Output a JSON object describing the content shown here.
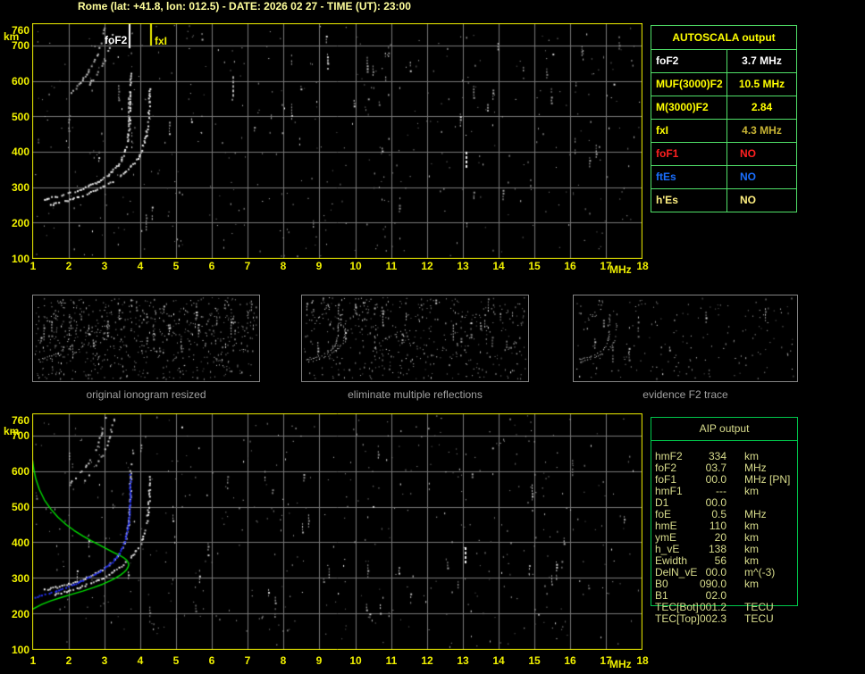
{
  "title": "Rome (lat: +41.8, lon: 012.5) - DATE: 2026 02 27 - TIME (UT): 23:00",
  "colors": {
    "background": "#000000",
    "title_text": "#FFFF9C",
    "axis_text": "#F0F000",
    "plot_border": "#F0F000",
    "grid": "#787878",
    "echo_white": "#FFFFFF",
    "autoscala_border": "#50E068",
    "aip_border": "#00C84C",
    "aip_text": "#D8DC8C",
    "caption_text": "#A0A0A0",
    "thumb_border": "#848484",
    "profile_green": "#00DD00",
    "restored_blue": "#2230F0",
    "marker_foF2": "#FFFFFF",
    "marker_fxI": "#F0F000"
  },
  "autoscala": {
    "title": "AUTOSCALA output",
    "rows": [
      {
        "label": "foF2",
        "value": "3.7 MHz",
        "label_color": "#FFFFFF",
        "value_color": "#FFFFFF",
        "value_align": "center"
      },
      {
        "label": "MUF(3000)F2",
        "value": "10.5 MHz",
        "label_color": "#FFFF00",
        "value_color": "#FFFF00",
        "value_align": "center"
      },
      {
        "label": "M(3000)F2",
        "value": "2.84",
        "label_color": "#FFFF00",
        "value_color": "#FFFF00",
        "value_align": "center"
      },
      {
        "label": "fxI",
        "value": "4.3 MHz",
        "label_color": "#FFFF00",
        "value_color": "#C8B434",
        "value_align": "center"
      },
      {
        "label": "foF1",
        "value": "NO",
        "label_color": "#FF2020",
        "value_color": "#FF2020",
        "value_align": "left"
      },
      {
        "label": "ftEs",
        "value": "NO",
        "label_color": "#1A6FFF",
        "value_color": "#1A6FFF",
        "value_align": "left"
      },
      {
        "label": "h'Es",
        "value": "NO",
        "label_color": "#FFF080",
        "value_color": "#FFF080",
        "value_align": "left"
      }
    ]
  },
  "aip": {
    "title": "AIP output",
    "rows": [
      {
        "label": "hmF2",
        "value": "334",
        "unit": "km",
        "note": ""
      },
      {
        "label": "foF2",
        "value": "03.7",
        "unit": "MHz",
        "note": ""
      },
      {
        "label": "foF1",
        "value": "00.0",
        "unit": "MHz",
        "note": "[PN]"
      },
      {
        "label": "hmF1",
        "value": "---",
        "unit": "km",
        "note": ""
      },
      {
        "label": "D1",
        "value": "00.0",
        "unit": "",
        "note": ""
      },
      {
        "label": "foE",
        "value": "0.5",
        "unit": "MHz",
        "note": ""
      },
      {
        "label": "hmE",
        "value": "110",
        "unit": "km",
        "note": ""
      },
      {
        "label": "ymE",
        "value": "20",
        "unit": "km",
        "note": ""
      },
      {
        "label": "h_vE",
        "value": "138",
        "unit": "km",
        "note": ""
      },
      {
        "label": "Ewidth",
        "value": "56",
        "unit": "km",
        "note": ""
      },
      {
        "label": "DelN_vE",
        "value": "00.0",
        "unit": "m^(-3)",
        "note": ""
      },
      {
        "label": "B0",
        "value": "090.0",
        "unit": "km",
        "note": ""
      },
      {
        "label": "B1",
        "value": "02.0",
        "unit": "",
        "note": ""
      },
      {
        "label": "TEC[Bot]",
        "value": "001.2",
        "unit": "TECU",
        "note": ""
      },
      {
        "label": "TEC[Top]",
        "value": "002.3",
        "unit": "TECU",
        "note": ""
      }
    ]
  },
  "thumbnails": [
    {
      "caption": "original ionogram resized"
    },
    {
      "caption": "eliminate multiple reflections"
    },
    {
      "caption": "evidence F2 trace"
    }
  ],
  "chart_data": {
    "type": "scatter",
    "description": "Two vertical-incidence ionograms (virtual height km vs frequency MHz); bottom panel adds Autoscala restored trace (blue) and electron density profile (green)",
    "x_unit": "MHz",
    "y_unit": "km",
    "xlim": [
      1,
      18
    ],
    "ylim": [
      100,
      760
    ],
    "grid": true,
    "x_ticks": [
      "1",
      "2",
      "3",
      "4",
      "5",
      "6",
      "7",
      "8",
      "9",
      "10",
      "11",
      "12",
      "13",
      "14",
      "15",
      "16",
      "17",
      "18"
    ],
    "y_ticks": [
      "760",
      "700",
      "600",
      "500",
      "400",
      "300",
      "200",
      "100"
    ],
    "markers": [
      {
        "label": "foF2",
        "f": 3.7,
        "color_key": "marker_foF2",
        "line_h": 27
      },
      {
        "label": "fxI",
        "f": 4.3,
        "color_key": "marker_fxI",
        "line_h": 24
      }
    ],
    "series": [
      {
        "name": "F2 trace O-mode echo",
        "points": [
          [
            1.3,
            268
          ],
          [
            1.45,
            271
          ],
          [
            1.62,
            275
          ],
          [
            1.8,
            279
          ],
          [
            1.98,
            284
          ],
          [
            2.16,
            290
          ],
          [
            2.34,
            296
          ],
          [
            2.52,
            304
          ],
          [
            2.7,
            312
          ],
          [
            2.88,
            322
          ],
          [
            3.05,
            333
          ],
          [
            3.2,
            346
          ],
          [
            3.33,
            360
          ],
          [
            3.44,
            377
          ],
          [
            3.53,
            397
          ],
          [
            3.6,
            420
          ],
          [
            3.65,
            447
          ],
          [
            3.68,
            478
          ],
          [
            3.7,
            512
          ],
          [
            3.71,
            550
          ],
          [
            3.715,
            590
          ],
          [
            3.72,
            628
          ]
        ]
      },
      {
        "name": "F2 trace X-mode echo",
        "points": [
          [
            1.5,
            252
          ],
          [
            1.7,
            257
          ],
          [
            1.92,
            263
          ],
          [
            2.15,
            270
          ],
          [
            2.38,
            278
          ],
          [
            2.61,
            287
          ],
          [
            2.84,
            297
          ],
          [
            3.06,
            308
          ],
          [
            3.27,
            321
          ],
          [
            3.46,
            335
          ],
          [
            3.63,
            350
          ],
          [
            3.78,
            366
          ],
          [
            3.91,
            384
          ],
          [
            4.02,
            404
          ],
          [
            4.1,
            428
          ],
          [
            4.16,
            455
          ],
          [
            4.2,
            486
          ],
          [
            4.23,
            520
          ],
          [
            4.245,
            556
          ],
          [
            4.25,
            592
          ]
        ]
      },
      {
        "name": "second-hop O-mode echo",
        "points": [
          [
            2.0,
            563
          ],
          [
            2.18,
            582
          ],
          [
            2.36,
            603
          ],
          [
            2.53,
            626
          ],
          [
            2.68,
            651
          ],
          [
            2.8,
            678
          ],
          [
            2.9,
            707
          ],
          [
            2.97,
            737
          ],
          [
            3.01,
            758
          ]
        ]
      },
      {
        "name": "second-hop X-mode echo",
        "points": [
          [
            2.38,
            570
          ],
          [
            2.56,
            591
          ],
          [
            2.74,
            615
          ],
          [
            2.9,
            641
          ],
          [
            3.03,
            669
          ],
          [
            3.13,
            699
          ],
          [
            3.21,
            731
          ],
          [
            3.26,
            756
          ]
        ]
      }
    ],
    "bottom_only": {
      "restored_trace": {
        "name": "Autoscala restored F2 trace",
        "color_key": "restored_blue",
        "points": [
          [
            1.05,
            247
          ],
          [
            1.25,
            253
          ],
          [
            1.45,
            259
          ],
          [
            1.66,
            266
          ],
          [
            1.87,
            273
          ],
          [
            2.08,
            281
          ],
          [
            2.29,
            290
          ],
          [
            2.5,
            300
          ],
          [
            2.7,
            310
          ],
          [
            2.9,
            322
          ],
          [
            3.08,
            335
          ],
          [
            3.24,
            350
          ],
          [
            3.38,
            367
          ],
          [
            3.49,
            387
          ],
          [
            3.57,
            410
          ],
          [
            3.63,
            436
          ],
          [
            3.67,
            465
          ],
          [
            3.69,
            497
          ],
          [
            3.7,
            532
          ],
          [
            3.705,
            566
          ],
          [
            3.71,
            598
          ]
        ]
      },
      "density_profile": {
        "name": "electron density profile (plasma frequency vs height)",
        "color_key": "profile_green",
        "points": [
          [
            1.0,
            212
          ],
          [
            1.25,
            225
          ],
          [
            1.5,
            235
          ],
          [
            1.8,
            245
          ],
          [
            2.1,
            254
          ],
          [
            2.4,
            263
          ],
          [
            2.7,
            273
          ],
          [
            2.95,
            282
          ],
          [
            3.15,
            291
          ],
          [
            3.32,
            300
          ],
          [
            3.45,
            308
          ],
          [
            3.55,
            316
          ],
          [
            3.62,
            323
          ],
          [
            3.66,
            330
          ],
          [
            3.68,
            336
          ],
          [
            3.67,
            342
          ],
          [
            3.63,
            349
          ],
          [
            3.55,
            356
          ],
          [
            3.43,
            363
          ],
          [
            3.27,
            371
          ],
          [
            3.08,
            381
          ],
          [
            2.87,
            392
          ],
          [
            2.64,
            404
          ],
          [
            2.4,
            418
          ],
          [
            2.16,
            433
          ],
          [
            1.93,
            450
          ],
          [
            1.71,
            470
          ],
          [
            1.51,
            493
          ],
          [
            1.33,
            519
          ],
          [
            1.19,
            548
          ],
          [
            1.09,
            578
          ],
          [
            1.03,
            606
          ],
          [
            1.0,
            630
          ]
        ]
      }
    },
    "interference": {
      "top": [
        {
          "f": 13.1,
          "h": [
            350,
            400
          ],
          "bright": true
        },
        {
          "f": 3.67,
          "h": [
            484,
            553
          ],
          "bright": false
        },
        {
          "f": 6.6,
          "h": [
            562,
            613
          ],
          "bright": false
        }
      ],
      "bottom": [
        {
          "f": 13.07,
          "h": [
            345,
            386
          ],
          "bright": true
        }
      ]
    },
    "noise": {
      "main_dots": 430,
      "main_streaks": 55,
      "thumbs": [
        {
          "dots": 650,
          "streaks": 36
        },
        {
          "dots": 480,
          "streaks": 26
        },
        {
          "dots": 170,
          "streaks": 8
        }
      ]
    }
  }
}
